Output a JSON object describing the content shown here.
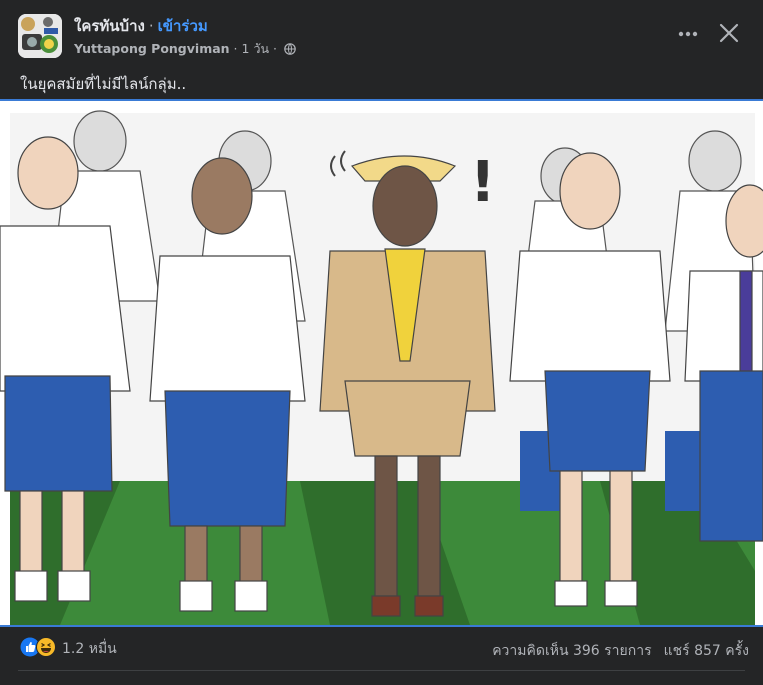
{
  "post": {
    "group_name": "ใครทันบ้าง",
    "join_label": "เข้าร่วม",
    "separator": "·",
    "author": "Yuttapong Pongviman",
    "time": "1 วัน",
    "text": "ในยุคสมัยที่ไม่มีไลน์กลุ่ม..",
    "icons": {
      "more": "more-horizontal-icon",
      "close": "close-icon",
      "privacy": "globe-icon",
      "like": "like-reaction-icon",
      "haha": "haha-reaction-icon"
    }
  },
  "footer": {
    "reaction_count": "1.2 หมื่น",
    "comments": "ความคิดเห็น 396 รายการ",
    "shares": "แชร์ 857 ครั้ง"
  },
  "colors": {
    "background": "#242526",
    "link_blue": "#4599ff",
    "secondary_text": "#b0b3b8",
    "primary_text": "#e4e6eb",
    "image_border": "#3a7bd5"
  }
}
